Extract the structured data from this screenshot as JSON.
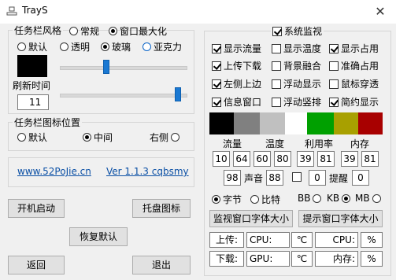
{
  "window": {
    "title": "TrayS",
    "close": "✕"
  },
  "taskbar_style": {
    "title": "任务栏风格",
    "modes": [
      "常规",
      "窗口最大化"
    ],
    "styles": [
      "默认",
      "透明",
      "玻璃",
      "亚克力"
    ],
    "color": "#000000",
    "slider1_level": 0.5,
    "refresh_label": "刷新时间",
    "refresh_value": "11",
    "slider2_level": 1.0
  },
  "icon_position": {
    "title": "任务栏图标位置",
    "options": [
      "默认",
      "中间",
      "右侧"
    ]
  },
  "links": {
    "site": "www.52PoJie.cn",
    "version": "Ver 1.1.3 cqbsmy"
  },
  "buttons": {
    "autostart": "开机启动",
    "tray_icon": "托盘图标",
    "restore": "恢复默认",
    "back": "返回",
    "exit": "退出"
  },
  "monitor": {
    "title": "系统监视",
    "checks": [
      "显示流量",
      "显示温度",
      "显示占用",
      "上传下载",
      "背景融合",
      "准确占用",
      "左侧上边",
      "浮动显示",
      "鼠标穿透",
      "信息窗口",
      "浮动竖排",
      "简约显示"
    ],
    "colors": [
      "#000000",
      "#808080",
      "#c0c0c0",
      "#ffffff",
      "#00a000",
      "#a8a000",
      "#a80000"
    ],
    "headers": [
      "流量",
      "温度",
      "利用率",
      "内存"
    ],
    "values_row1": [
      "10",
      "64",
      "60",
      "80",
      "39",
      "81",
      "39",
      "81"
    ],
    "row2": {
      "v1": "98",
      "sound_label": "声音",
      "v2": "88",
      "v3": "0",
      "remind_label": "提醒",
      "v4": "0"
    },
    "units": [
      "字节",
      "比特",
      "BB",
      "KB",
      "MB"
    ],
    "font_btn1": "监视窗口字体大小",
    "font_btn2": "提示窗口字体大小",
    "upload_label": "上传:",
    "download_label": "下载:",
    "cpu_label": "CPU:",
    "cpu_unit": "℃",
    "gpu_label": "GPU:",
    "gpu_unit": "℃",
    "cpu_label2": "CPU:",
    "pct1": "%",
    "mem_label": "内存:",
    "pct2": "%"
  }
}
